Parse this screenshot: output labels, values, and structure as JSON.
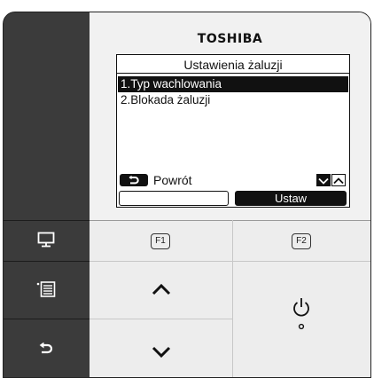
{
  "brand": "TOSHIBA",
  "screen": {
    "title": "Ustawienia żaluzji",
    "menu": [
      {
        "label": "1.Typ wachlowania",
        "selected": true
      },
      {
        "label": "2.Blokada żaluzji",
        "selected": false
      }
    ],
    "back_label": "Powrót",
    "f1_label": "",
    "f2_label": "Ustaw"
  },
  "keys": {
    "f1": "F1",
    "f2": "F2"
  },
  "icons": {
    "monitor": "monitor-icon",
    "menu": "menu-list-icon",
    "back": "return-icon",
    "up": "chevron-up-icon",
    "down": "chevron-down-icon",
    "power": "power-icon"
  },
  "colors": {
    "panel_dark": "#3b3b3b",
    "panel_light": "#ededed",
    "lcd_bg": "#ffffff",
    "lcd_ink": "#111111"
  }
}
